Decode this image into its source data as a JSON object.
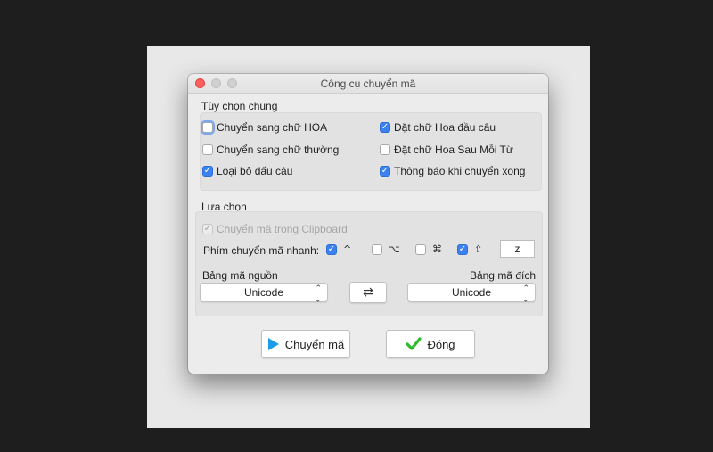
{
  "window": {
    "title": "Công cụ chuyển mã"
  },
  "general": {
    "label": "Tùy chọn chung",
    "options": [
      {
        "label": "Chuyển sang chữ HOA",
        "checked": false
      },
      {
        "label": "Chuyển sang chữ thường",
        "checked": false
      },
      {
        "label": "Loại bỏ dấu câu",
        "checked": true
      },
      {
        "label": "Đặt chữ Hoa đầu câu",
        "checked": true
      },
      {
        "label": "Đặt chữ Hoa Sau Mỗi Từ",
        "checked": false
      },
      {
        "label": "Thông báo khi chuyển xong",
        "checked": true
      }
    ]
  },
  "selection": {
    "label": "Lựa chọn",
    "clipboard_label": "Chuyển mã trong Clipboard",
    "hotkey_label": "Phím chuyển mã nhanh:",
    "modifiers": [
      {
        "symbol": "^",
        "name": "control",
        "checked": true
      },
      {
        "symbol": "⌥",
        "name": "option",
        "checked": false
      },
      {
        "symbol": "⌘",
        "name": "command",
        "checked": false
      },
      {
        "symbol": "⇧",
        "name": "shift",
        "checked": true
      }
    ],
    "key": "z",
    "source_label": "Bảng mã nguồn",
    "target_label": "Bảng mã đích",
    "source_value": "Unicode",
    "target_value": "Unicode"
  },
  "buttons": {
    "convert_label": "Chuyển mã",
    "close_label": "Đóng"
  },
  "colors": {
    "accent": "#3b82f0",
    "play_icon": "#1e9be8",
    "check_icon": "#2dbb2d"
  }
}
